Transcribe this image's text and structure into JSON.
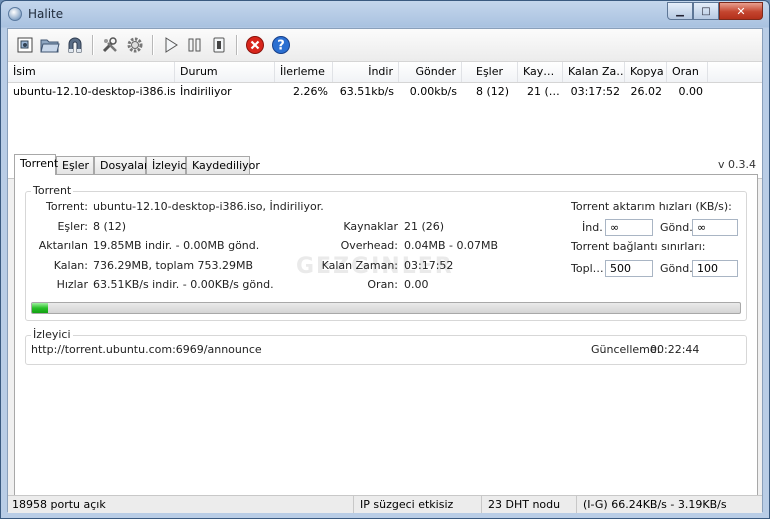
{
  "window": {
    "title": "Halite"
  },
  "toolbar": {
    "icons": [
      "open-torrent-icon",
      "folder-icon",
      "magnet-icon",
      "settings-tools-icon",
      "gear-icon",
      "play-icon",
      "pause-icon",
      "stop-icon",
      "remove-icon",
      "help-icon"
    ]
  },
  "list": {
    "columns": [
      "İsim",
      "Durum",
      "İlerleme",
      "İndir",
      "Gönder",
      "Eşler",
      "Kay…",
      "Kalan Za…",
      "Kopya",
      "Oran"
    ],
    "rows": [
      [
        "ubuntu-12.10-desktop-i386.iso",
        "İndiriliyor",
        "2.26%",
        "63.51kb/s",
        "0.00kb/s",
        "8 (12)",
        "21 (…",
        "03:17:52",
        "26.02",
        "0.00"
      ]
    ]
  },
  "tabs": [
    "Torrent",
    "Eşler",
    "Dosyalar",
    "İzleyici",
    "Kaydediliyor"
  ],
  "version": "v 0.3.4",
  "torrent": {
    "group_label": "Torrent",
    "torrent_label": "Torrent:",
    "torrent_value": "ubuntu-12.10-desktop-i386.iso, İndiriliyor.",
    "peers_label": "Eşler:",
    "peers_value": "8 (12)",
    "transferred_label": "Aktarılan",
    "transferred_value": "19.85MB indir. - 0.00MB gönd.",
    "remaining_label": "Kalan:",
    "remaining_value": "736.29MB, toplam 753.29MB",
    "speeds_label": "Hızlar",
    "speeds_value": "63.51KB/s indir. - 0.00KB/s gönd.",
    "sources_label": "Kaynaklar",
    "sources_value": "21 (26)",
    "overhead_label": "Overhead:",
    "overhead_value": "0.04MB - 0.07MB",
    "time_left_label": "Kalan Zaman:",
    "time_left_value": "03:17:52",
    "ratio_label": "Oran:",
    "ratio_value": "0.00",
    "rate_limits_title": "Torrent aktarım hızları (KB/s):",
    "down_label": "İnd.",
    "down_value": "∞",
    "up_label": "Gönd.",
    "up_value": "∞",
    "conn_limits_title": "Torrent bağlantı sınırları:",
    "total_label": "Topl…",
    "total_value": "500",
    "conn_up_label": "Gönd.",
    "conn_up_value": "100",
    "progress": 0.0226,
    "progress_color": "#28c028"
  },
  "tracker": {
    "group_label": "İzleyici",
    "url": "http://torrent.ubuntu.com:6969/announce",
    "update_label": "Güncelleme:",
    "update_value": "00:22:44"
  },
  "statusbar": {
    "port": "18958 portu açık",
    "ip_filter": "IP süzgeci etkisiz",
    "dht": "23 DHT nodu",
    "rates": "(I-G) 66.24KB/s - 3.19KB/s"
  }
}
